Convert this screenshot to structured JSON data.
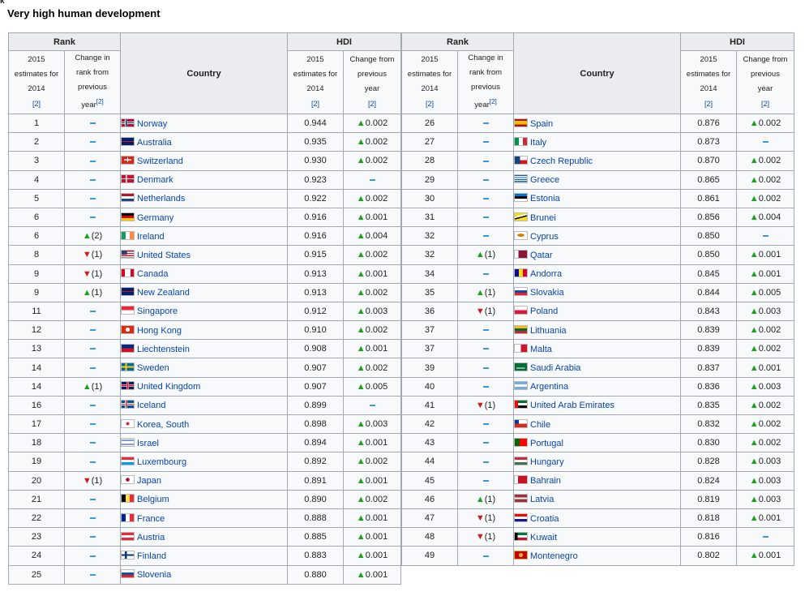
{
  "page": {
    "corner_glyph": "ᴋ",
    "section_title": "Very high human development"
  },
  "headers": {
    "rank": "Rank",
    "country": "Country",
    "hdi": "HDI",
    "estimates_line1": "2015",
    "estimates_line2": "estimates for",
    "estimates_line3": "2014",
    "change_rank_line1": "Change in",
    "change_rank_line2": "rank from",
    "change_rank_line3": "previous",
    "change_rank_line4": "year",
    "change_hdi_line1": "Change from",
    "change_hdi_line2": "previous",
    "change_hdi_line3": "year",
    "ref": "[2]"
  },
  "colors": {
    "header_bg": "#eaecf0",
    "cell_bg": "#f8f9fa",
    "border": "#a2a9b1",
    "link": "#0645ad",
    "increase": "#19a119",
    "decrease": "#d11a1a",
    "steady": "#3a9ad9"
  },
  "icons": {
    "increase": "increase-triangle-icon",
    "decrease": "decrease-triangle-icon",
    "steady": "steady-dash-icon"
  },
  "left_rows": [
    {
      "rank": "1",
      "rc": "steady",
      "rcn": "",
      "country": "Norway",
      "flag": "norway",
      "hdi": "0.944",
      "hc": "increase",
      "hcv": "0.002"
    },
    {
      "rank": "2",
      "rc": "steady",
      "rcn": "",
      "country": "Australia",
      "flag": "australia",
      "hdi": "0.935",
      "hc": "increase",
      "hcv": "0.002"
    },
    {
      "rank": "3",
      "rc": "steady",
      "rcn": "",
      "country": "Switzerland",
      "flag": "switzerland",
      "hdi": "0.930",
      "hc": "increase",
      "hcv": "0.002"
    },
    {
      "rank": "4",
      "rc": "steady",
      "rcn": "",
      "country": "Denmark",
      "flag": "denmark",
      "hdi": "0.923",
      "hc": "steady",
      "hcv": ""
    },
    {
      "rank": "5",
      "rc": "steady",
      "rcn": "",
      "country": "Netherlands",
      "flag": "netherlands",
      "hdi": "0.922",
      "hc": "increase",
      "hcv": "0.002"
    },
    {
      "rank": "6",
      "rc": "steady",
      "rcn": "",
      "country": "Germany",
      "flag": "germany",
      "hdi": "0.916",
      "hc": "increase",
      "hcv": "0.001"
    },
    {
      "rank": "6",
      "rc": "increase",
      "rcn": "(2)",
      "country": "Ireland",
      "flag": "ireland",
      "hdi": "0.916",
      "hc": "increase",
      "hcv": "0.004"
    },
    {
      "rank": "8",
      "rc": "decrease",
      "rcn": "(1)",
      "country": "United States",
      "flag": "united-states",
      "hdi": "0.915",
      "hc": "increase",
      "hcv": "0.002"
    },
    {
      "rank": "9",
      "rc": "decrease",
      "rcn": "(1)",
      "country": "Canada",
      "flag": "canada",
      "hdi": "0.913",
      "hc": "increase",
      "hcv": "0.001"
    },
    {
      "rank": "9",
      "rc": "increase",
      "rcn": "(1)",
      "country": "New Zealand",
      "flag": "new-zealand",
      "hdi": "0.913",
      "hc": "increase",
      "hcv": "0.002"
    },
    {
      "rank": "11",
      "rc": "steady",
      "rcn": "",
      "country": "Singapore",
      "flag": "singapore",
      "hdi": "0.912",
      "hc": "increase",
      "hcv": "0.003"
    },
    {
      "rank": "12",
      "rc": "steady",
      "rcn": "",
      "country": "Hong Kong",
      "flag": "hong-kong",
      "hdi": "0.910",
      "hc": "increase",
      "hcv": "0.002"
    },
    {
      "rank": "13",
      "rc": "steady",
      "rcn": "",
      "country": "Liechtenstein",
      "flag": "liechtenstein",
      "hdi": "0.908",
      "hc": "increase",
      "hcv": "0.001"
    },
    {
      "rank": "14",
      "rc": "steady",
      "rcn": "",
      "country": "Sweden",
      "flag": "sweden",
      "hdi": "0.907",
      "hc": "increase",
      "hcv": "0.002"
    },
    {
      "rank": "14",
      "rc": "increase",
      "rcn": "(1)",
      "country": "United Kingdom",
      "flag": "united-kingdom",
      "hdi": "0.907",
      "hc": "increase",
      "hcv": "0.005"
    },
    {
      "rank": "16",
      "rc": "steady",
      "rcn": "",
      "country": "Iceland",
      "flag": "iceland",
      "hdi": "0.899",
      "hc": "steady",
      "hcv": ""
    },
    {
      "rank": "17",
      "rc": "steady",
      "rcn": "",
      "country": "Korea, South",
      "flag": "south-korea",
      "hdi": "0.898",
      "hc": "increase",
      "hcv": "0.003"
    },
    {
      "rank": "18",
      "rc": "steady",
      "rcn": "",
      "country": "Israel",
      "flag": "israel",
      "hdi": "0.894",
      "hc": "increase",
      "hcv": "0.001"
    },
    {
      "rank": "19",
      "rc": "steady",
      "rcn": "",
      "country": "Luxembourg",
      "flag": "luxembourg",
      "hdi": "0.892",
      "hc": "increase",
      "hcv": "0.002"
    },
    {
      "rank": "20",
      "rc": "decrease",
      "rcn": "(1)",
      "country": "Japan",
      "flag": "japan",
      "hdi": "0.891",
      "hc": "increase",
      "hcv": "0.001"
    },
    {
      "rank": "21",
      "rc": "steady",
      "rcn": "",
      "country": "Belgium",
      "flag": "belgium",
      "hdi": "0.890",
      "hc": "increase",
      "hcv": "0.002"
    },
    {
      "rank": "22",
      "rc": "steady",
      "rcn": "",
      "country": "France",
      "flag": "france",
      "hdi": "0.888",
      "hc": "increase",
      "hcv": "0.001"
    },
    {
      "rank": "23",
      "rc": "steady",
      "rcn": "",
      "country": "Austria",
      "flag": "austria",
      "hdi": "0.885",
      "hc": "increase",
      "hcv": "0.001"
    },
    {
      "rank": "24",
      "rc": "steady",
      "rcn": "",
      "country": "Finland",
      "flag": "finland",
      "hdi": "0.883",
      "hc": "increase",
      "hcv": "0.001"
    },
    {
      "rank": "25",
      "rc": "steady",
      "rcn": "",
      "country": "Slovenia",
      "flag": "slovenia",
      "hdi": "0.880",
      "hc": "increase",
      "hcv": "0.001"
    }
  ],
  "right_rows": [
    {
      "rank": "26",
      "rc": "steady",
      "rcn": "",
      "country": "Spain",
      "flag": "spain",
      "hdi": "0.876",
      "hc": "increase",
      "hcv": "0.002"
    },
    {
      "rank": "27",
      "rc": "steady",
      "rcn": "",
      "country": "Italy",
      "flag": "italy",
      "hdi": "0.873",
      "hc": "steady",
      "hcv": ""
    },
    {
      "rank": "28",
      "rc": "steady",
      "rcn": "",
      "country": "Czech Republic",
      "flag": "czech-republic",
      "hdi": "0.870",
      "hc": "increase",
      "hcv": "0.002"
    },
    {
      "rank": "29",
      "rc": "steady",
      "rcn": "",
      "country": "Greece",
      "flag": "greece",
      "hdi": "0.865",
      "hc": "increase",
      "hcv": "0.002"
    },
    {
      "rank": "30",
      "rc": "steady",
      "rcn": "",
      "country": "Estonia",
      "flag": "estonia",
      "hdi": "0.861",
      "hc": "increase",
      "hcv": "0.002"
    },
    {
      "rank": "31",
      "rc": "steady",
      "rcn": "",
      "country": "Brunei",
      "flag": "brunei",
      "hdi": "0.856",
      "hc": "increase",
      "hcv": "0.004"
    },
    {
      "rank": "32",
      "rc": "steady",
      "rcn": "",
      "country": "Cyprus",
      "flag": "cyprus",
      "hdi": "0.850",
      "hc": "steady",
      "hcv": ""
    },
    {
      "rank": "32",
      "rc": "increase",
      "rcn": "(1)",
      "country": "Qatar",
      "flag": "qatar",
      "hdi": "0.850",
      "hc": "increase",
      "hcv": "0.001"
    },
    {
      "rank": "34",
      "rc": "steady",
      "rcn": "",
      "country": "Andorra",
      "flag": "andorra",
      "hdi": "0.845",
      "hc": "increase",
      "hcv": "0.001"
    },
    {
      "rank": "35",
      "rc": "increase",
      "rcn": "(1)",
      "country": "Slovakia",
      "flag": "slovakia",
      "hdi": "0.844",
      "hc": "increase",
      "hcv": "0.005"
    },
    {
      "rank": "36",
      "rc": "decrease",
      "rcn": "(1)",
      "country": "Poland",
      "flag": "poland",
      "hdi": "0.843",
      "hc": "increase",
      "hcv": "0.003"
    },
    {
      "rank": "37",
      "rc": "steady",
      "rcn": "",
      "country": "Lithuania",
      "flag": "lithuania",
      "hdi": "0.839",
      "hc": "increase",
      "hcv": "0.002"
    },
    {
      "rank": "37",
      "rc": "steady",
      "rcn": "",
      "country": "Malta",
      "flag": "malta",
      "hdi": "0.839",
      "hc": "increase",
      "hcv": "0.002"
    },
    {
      "rank": "39",
      "rc": "steady",
      "rcn": "",
      "country": "Saudi Arabia",
      "flag": "saudi-arabia",
      "hdi": "0.837",
      "hc": "increase",
      "hcv": "0.001"
    },
    {
      "rank": "40",
      "rc": "steady",
      "rcn": "",
      "country": "Argentina",
      "flag": "argentina",
      "hdi": "0.836",
      "hc": "increase",
      "hcv": "0.003"
    },
    {
      "rank": "41",
      "rc": "decrease",
      "rcn": "(1)",
      "country": "United Arab Emirates",
      "flag": "united-arab-emirates",
      "hdi": "0.835",
      "hc": "increase",
      "hcv": "0.002"
    },
    {
      "rank": "42",
      "rc": "steady",
      "rcn": "",
      "country": "Chile",
      "flag": "chile",
      "hdi": "0.832",
      "hc": "increase",
      "hcv": "0.002"
    },
    {
      "rank": "43",
      "rc": "steady",
      "rcn": "",
      "country": "Portugal",
      "flag": "portugal",
      "hdi": "0.830",
      "hc": "increase",
      "hcv": "0.002"
    },
    {
      "rank": "44",
      "rc": "steady",
      "rcn": "",
      "country": "Hungary",
      "flag": "hungary",
      "hdi": "0.828",
      "hc": "increase",
      "hcv": "0.003"
    },
    {
      "rank": "45",
      "rc": "steady",
      "rcn": "",
      "country": "Bahrain",
      "flag": "bahrain",
      "hdi": "0.824",
      "hc": "increase",
      "hcv": "0.003"
    },
    {
      "rank": "46",
      "rc": "increase",
      "rcn": "(1)",
      "country": "Latvia",
      "flag": "latvia",
      "hdi": "0.819",
      "hc": "increase",
      "hcv": "0.003"
    },
    {
      "rank": "47",
      "rc": "decrease",
      "rcn": "(1)",
      "country": "Croatia",
      "flag": "croatia",
      "hdi": "0.818",
      "hc": "increase",
      "hcv": "0.001"
    },
    {
      "rank": "48",
      "rc": "decrease",
      "rcn": "(1)",
      "country": "Kuwait",
      "flag": "kuwait",
      "hdi": "0.816",
      "hc": "steady",
      "hcv": ""
    },
    {
      "rank": "49",
      "rc": "steady",
      "rcn": "",
      "country": "Montenegro",
      "flag": "montenegro",
      "hdi": "0.802",
      "hc": "increase",
      "hcv": "0.001"
    }
  ]
}
